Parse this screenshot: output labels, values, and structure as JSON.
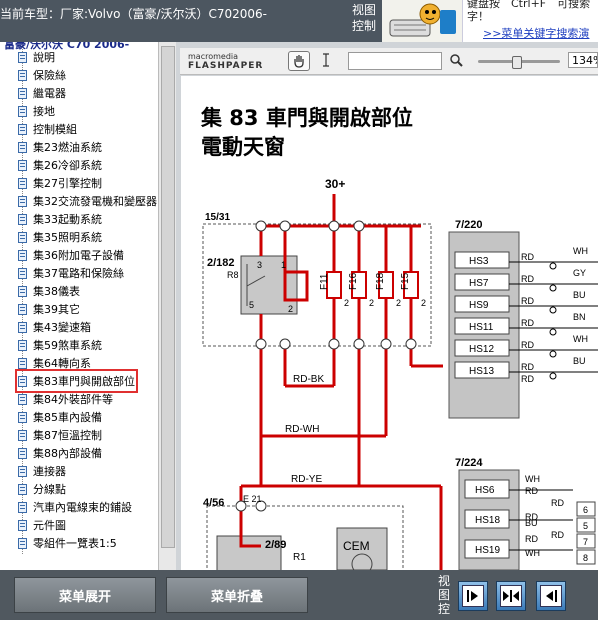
{
  "header": {
    "car_title": "当前车型：厂家:Volvo（富豪/沃尔沃）C702006-",
    "view_control_label": "视图控制",
    "tip_line1": "键盘按　Ctrl+F　可搜索",
    "tip_line2": "字！",
    "tip_link": ">>菜单关键字搜索演"
  },
  "tree": {
    "head": "富豪/沃尔沃 C70 2006-",
    "items": [
      {
        "label": "說明"
      },
      {
        "label": "保險絲"
      },
      {
        "label": "繼電器"
      },
      {
        "label": "接地"
      },
      {
        "label": "控制模組"
      },
      {
        "label": "集23燃油系統"
      },
      {
        "label": "集26冷卻系統"
      },
      {
        "label": "集27引擎控制"
      },
      {
        "label": "集32交流發電機和變壓器"
      },
      {
        "label": "集33起動系統"
      },
      {
        "label": "集35照明系統"
      },
      {
        "label": "集36附加電子設備"
      },
      {
        "label": "集37電路和保險絲"
      },
      {
        "label": "集38儀表"
      },
      {
        "label": "集39其它"
      },
      {
        "label": "集43變速箱"
      },
      {
        "label": "集59煞車系統"
      },
      {
        "label": "集64轉向系"
      },
      {
        "label": "集83車門與開啟部位"
      },
      {
        "label": "集84外裝部件等"
      },
      {
        "label": "集85車內設備"
      },
      {
        "label": "集87恒溫控制"
      },
      {
        "label": "集88內部設備"
      },
      {
        "label": "連接器"
      },
      {
        "label": "分線點"
      },
      {
        "label": "汽車內電線束的鋪設"
      },
      {
        "label": "元件圖"
      },
      {
        "label": "零組件一覽表1:5"
      }
    ],
    "selected_index": 18
  },
  "toolbar": {
    "logo_small": "macromedia",
    "logo_big": "FLASHPAPER",
    "zoom_value": "134%",
    "hand_icon": "hand-icon",
    "text_icon": "text-cursor-icon",
    "search_icon": "search-icon"
  },
  "document": {
    "title_line1": "集 83 車門與開啟部位",
    "title_line2": "電動天窗",
    "labels": {
      "supply": "30+",
      "j1531": "15/31",
      "j2182": "2/182",
      "r8": "R8",
      "r8_pin3": "3",
      "r8_pin1": "1",
      "r8_pin5": "5",
      "r8_pin2": "2",
      "f11": "F11",
      "f16": "F16",
      "f18": "F18",
      "f15": "F15",
      "fuse_pin2a": "2",
      "fuse_pin2b": "2",
      "fuse_pin2c": "2",
      "fuse_pin2d": "2",
      "rdbk": "RD-BK",
      "rdwh": "RD-WH",
      "rdye": "RD-YE",
      "j7220": "7/220",
      "j7224": "7/224",
      "j456": "4/56",
      "e21": "E 21",
      "j289": "2/89",
      "r1": "R1",
      "cem": "CEM"
    },
    "right_block_1": [
      {
        "hs": "HS3",
        "wire": "RD",
        "out": "WH"
      },
      {
        "hs": "HS7",
        "wire": "RD",
        "out": "GY"
      },
      {
        "hs": "HS9",
        "wire": "RD",
        "out": "BU"
      },
      {
        "hs": "HS11",
        "wire": "RD",
        "out": "BN"
      },
      {
        "hs": "HS12",
        "wire": "RD",
        "out": "WH"
      },
      {
        "hs": "HS13",
        "wire": "RD",
        "out": "BU"
      }
    ],
    "right_block_1_extra": "RD",
    "right_block_2": [
      {
        "hs": "HS6",
        "wire": "WH"
      },
      {
        "hs": "HS18",
        "wire": "RD"
      },
      {
        "hs": "HS19",
        "wire": "BU"
      }
    ],
    "right_block_2_labels": [
      "WH",
      "RD",
      "RD",
      "RD",
      "BU",
      "RD",
      "RD",
      "WH"
    ],
    "right_block_2_pins": [
      "6",
      "5",
      "7",
      "8"
    ]
  },
  "bottom": {
    "expand_label": "菜单展开",
    "collapse_label": "菜单折叠",
    "view_control_label": "视图控",
    "nav_icons": [
      "arrow-right-icon",
      "arrows-split-icon",
      "arrow-left-icon"
    ]
  },
  "colors": {
    "wire_red": "#cc0000",
    "accent_blue": "#2a6ab0",
    "selected_outline": "#e03030"
  }
}
